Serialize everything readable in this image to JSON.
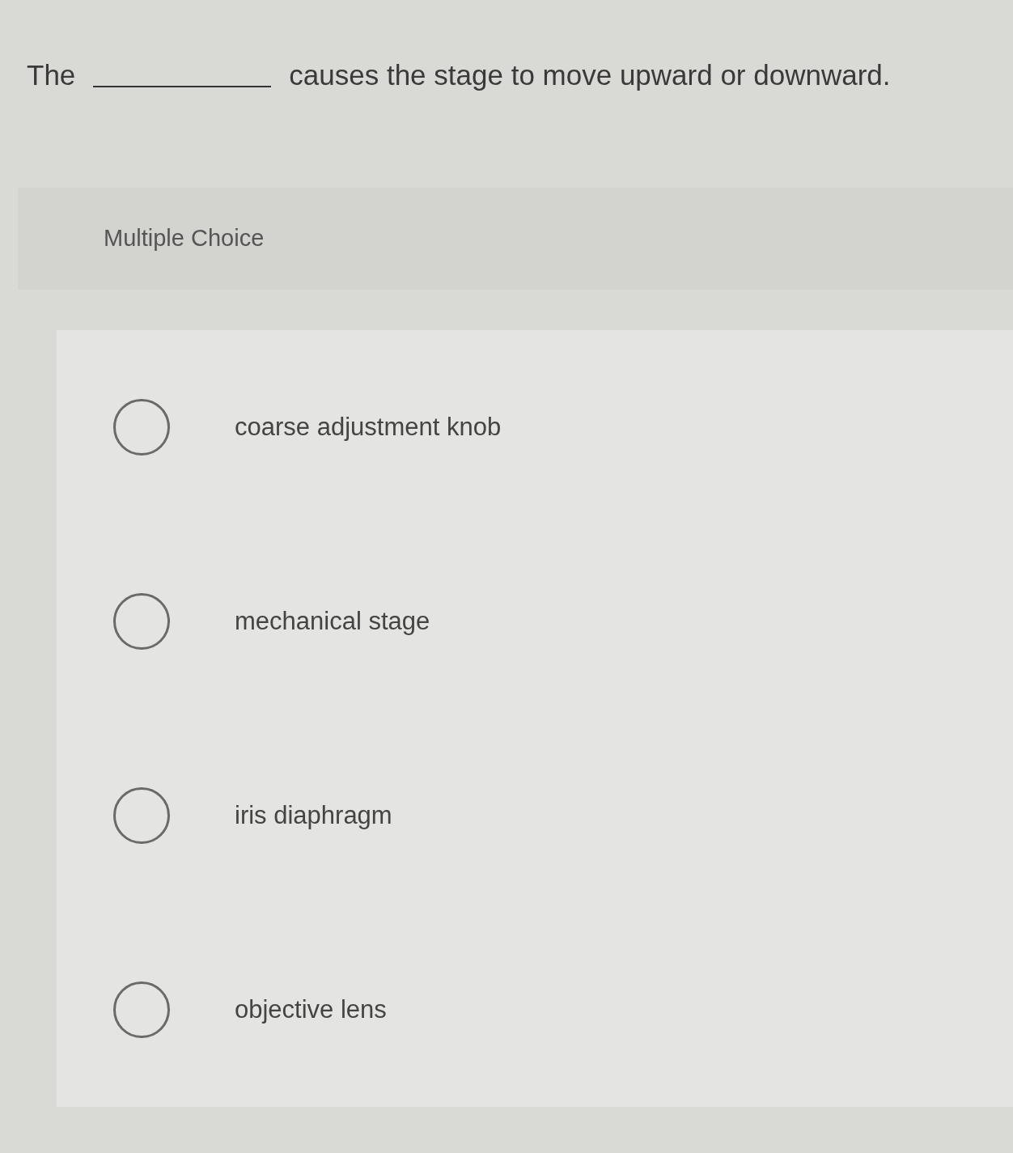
{
  "question": {
    "parts": [
      {
        "kind": "text",
        "text": "The"
      },
      {
        "kind": "blank"
      },
      {
        "kind": "text",
        "text": "causes the stage to move upward or downward."
      }
    ]
  },
  "question_type": "Multiple Choice",
  "options": [
    {
      "label": "coarse adjustment knob",
      "selected": false
    },
    {
      "label": "mechanical stage",
      "selected": false
    },
    {
      "label": "iris diaphragm",
      "selected": false
    },
    {
      "label": "objective lens",
      "selected": false
    }
  ]
}
